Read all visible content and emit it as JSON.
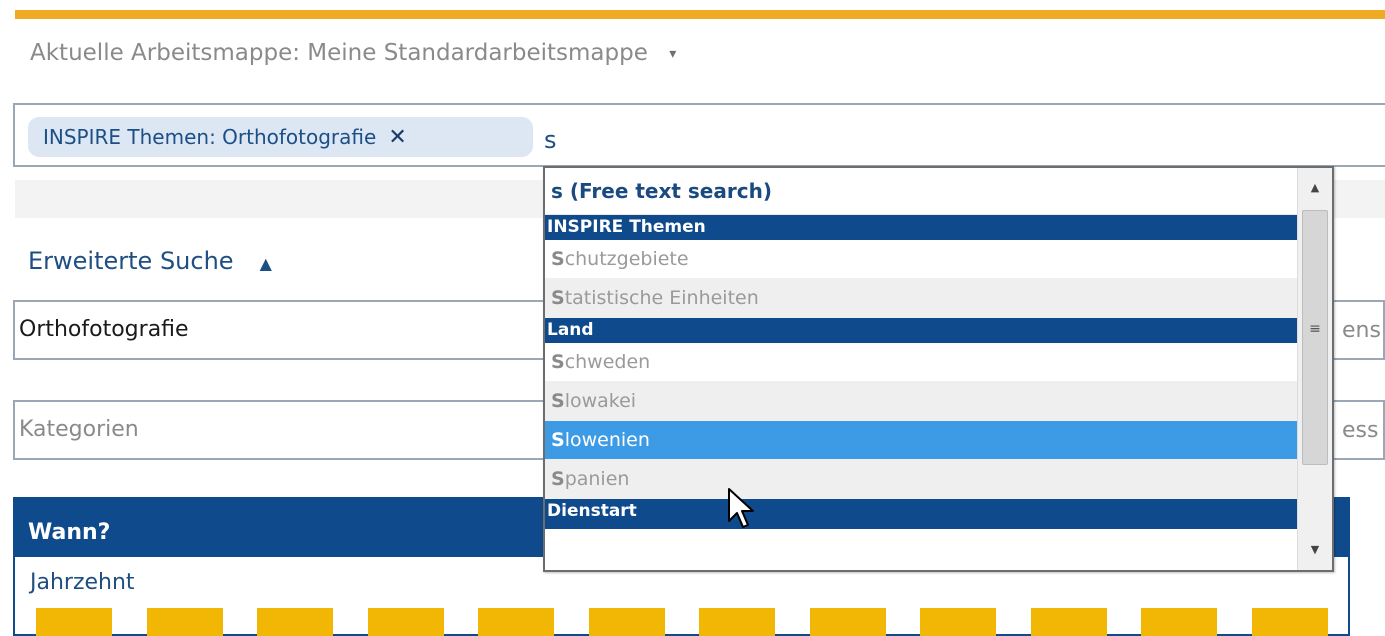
{
  "workbook": {
    "label": "Aktuelle Arbeitsmappe: Meine Standardarbeitsmappe",
    "caret_icon": "▾"
  },
  "search": {
    "tag_label": "INSPIRE Themen: Orthofotografie",
    "tag_close": "✕",
    "typed_text": "s"
  },
  "advanced": {
    "label": "Erweiterte Suche",
    "toggle_icon": "▲"
  },
  "fields": {
    "orthofoto_value": "Orthofotografie",
    "orthofoto_side_text": "ens",
    "kategorien_placeholder": "Kategorien",
    "kategorien_side_text": "ess"
  },
  "wann": {
    "title": "Wann?",
    "decade_label": "Jahrzehnt",
    "bar_color": "#f2b705",
    "bar_count": 12
  },
  "dropdown": {
    "free_text": "s (Free text search)",
    "groups": [
      {
        "title": "INSPIRE Themen",
        "items": [
          {
            "first": "S",
            "rest": "chutzgebiete"
          },
          {
            "first": "S",
            "rest": "tatistische Einheiten"
          }
        ]
      },
      {
        "title": "Land",
        "items": [
          {
            "first": "S",
            "rest": "chweden"
          },
          {
            "first": "S",
            "rest": "lowakei"
          },
          {
            "first": "S",
            "rest": "lowenien"
          },
          {
            "first": "S",
            "rest": "panien"
          }
        ]
      },
      {
        "title": "Dienstart",
        "items": []
      }
    ],
    "selected_item": "Slowenien"
  },
  "colors": {
    "accent_bar": "#f0aa23",
    "header_blue": "#0f4b8c",
    "selected_blue": "#3d9ae5",
    "tag_bg": "#dde7f3"
  }
}
